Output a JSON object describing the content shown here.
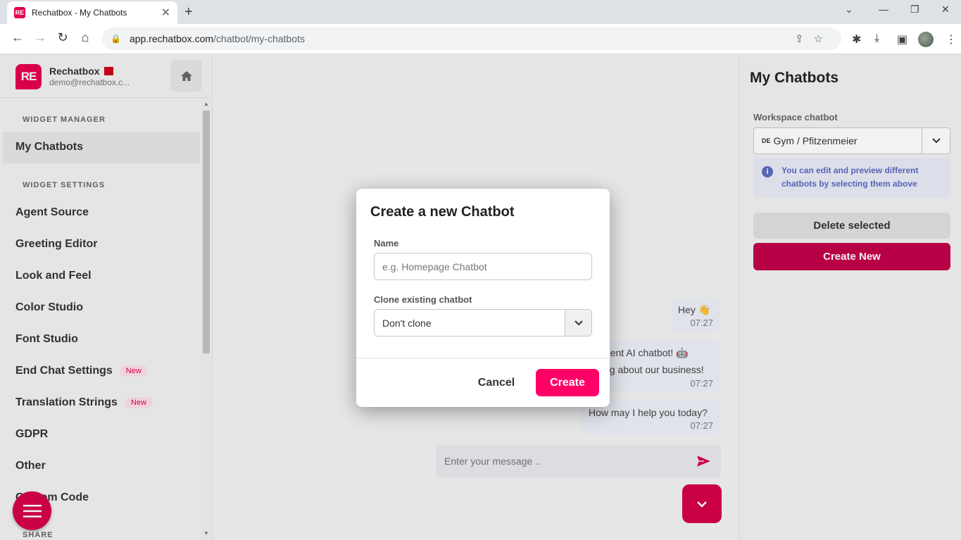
{
  "browser": {
    "tab_title": "Rechatbox - My Chatbots",
    "favicon_text": "RE",
    "url_host": "app.rechatbox.com",
    "url_path": "/chatbot/my-chatbots"
  },
  "sidebar": {
    "brand_name": "Rechatbox",
    "brand_email": "demo@rechatbox.c...",
    "logo_text": "RE",
    "section_widget_manager": "WIDGET MANAGER",
    "section_widget_settings": "WIDGET SETTINGS",
    "section_share": "SHARE",
    "items": [
      {
        "label": "My Chatbots"
      },
      {
        "label": "Agent Source"
      },
      {
        "label": "Greeting Editor"
      },
      {
        "label": "Look and Feel"
      },
      {
        "label": "Color Studio"
      },
      {
        "label": "Font Studio"
      },
      {
        "label": "End Chat Settings",
        "badge": "New"
      },
      {
        "label": "Translation Strings",
        "badge": "New"
      },
      {
        "label": "GDPR"
      },
      {
        "label": "Other"
      },
      {
        "label": "Custom Code"
      }
    ]
  },
  "chat": {
    "messages": [
      {
        "text": "Hey 👋",
        "time": "07:27"
      },
      {
        "text_line1": "gent AI chatbot! 🤖",
        "text_line2": "ng about our business!",
        "time": "07:27"
      },
      {
        "text": "How may I help you today?",
        "time": "07:27"
      }
    ],
    "input_placeholder": "Enter your message .."
  },
  "right_panel": {
    "title": "My Chatbots",
    "workspace_label": "Workspace chatbot",
    "workspace_prefix": "DE",
    "workspace_value": "Gym / Pfitzenmeier",
    "info_text": "You can edit and preview different chatbots by selecting them above",
    "delete_label": "Delete selected",
    "create_label": "Create New"
  },
  "modal": {
    "title": "Create a new Chatbot",
    "name_label": "Name",
    "name_placeholder": "e.g. Homepage Chatbot",
    "clone_label": "Clone existing chatbot",
    "clone_value": "Don't clone",
    "cancel_label": "Cancel",
    "create_label": "Create"
  },
  "colors": {
    "brand": "#e5004f",
    "primary_button": "#ff0066",
    "info": "#5c6bc0"
  }
}
